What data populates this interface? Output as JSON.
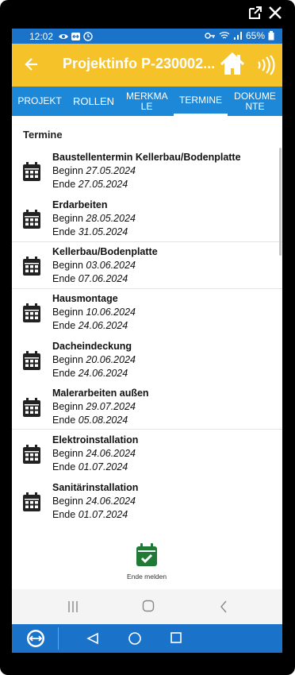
{
  "status": {
    "time": "12:02",
    "battery": "65%"
  },
  "appbar": {
    "title": "Projektinfo P-230002..."
  },
  "tabs": [
    "PROJEKT",
    "ROLLEN",
    "MERKMA LE",
    "TERMINE",
    "DOKUME NTE"
  ],
  "section_title": "Termine",
  "appointments": [
    {
      "name": "Baustellentermin Kellerbau/Bodenplatte",
      "begin_label": "Beginn",
      "begin": "27.05.2024",
      "end_label": "Ende",
      "end": "27.05.2024"
    },
    {
      "name": "Erdarbeiten",
      "begin_label": "Beginn",
      "begin": "28.05.2024",
      "end_label": "Ende",
      "end": "31.05.2024"
    },
    {
      "name": "Kellerbau/Bodenplatte",
      "begin_label": "Beginn",
      "begin": "03.06.2024",
      "end_label": "Ende",
      "end": "07.06.2024"
    },
    {
      "name": "Hausmontage",
      "begin_label": "Beginn",
      "begin": "10.06.2024",
      "end_label": "Ende",
      "end": "24.06.2024"
    },
    {
      "name": "Dacheindeckung",
      "begin_label": "Beginn",
      "begin": "20.06.2024",
      "end_label": "Ende",
      "end": "24.06.2024"
    },
    {
      "name": "Malerarbeiten außen",
      "begin_label": "Beginn",
      "begin": "29.07.2024",
      "end_label": "Ende",
      "end": "05.08.2024"
    },
    {
      "name": "Elektroinstallation",
      "begin_label": "Beginn",
      "begin": "24.06.2024",
      "end_label": "Ende",
      "end": "01.07.2024"
    },
    {
      "name": "Sanitärinstallation",
      "begin_label": "Beginn",
      "begin": "24.06.2024",
      "end_label": "Ende",
      "end": "01.07.2024"
    }
  ],
  "action": {
    "label": "Ende melden"
  },
  "colors": {
    "appbar": "#f6c22a",
    "tabs": "#1e88d8",
    "status": "#1a73c9",
    "action_icon": "#1f7a36"
  }
}
